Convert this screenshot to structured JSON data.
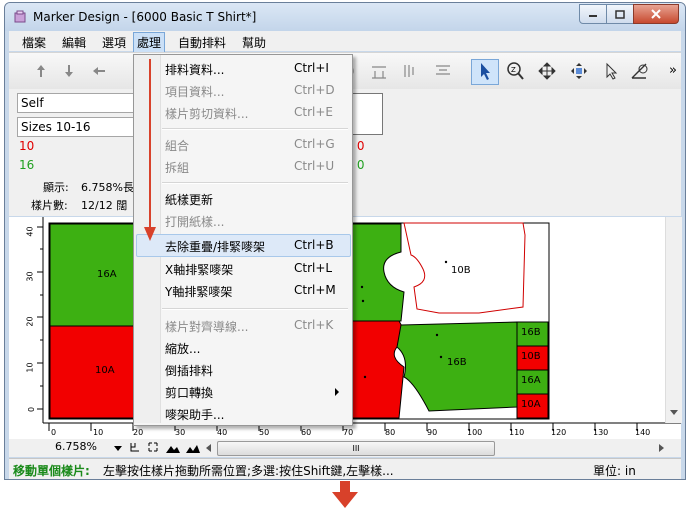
{
  "window": {
    "title": "Marker Design - [6000 Basic T Shirt*]"
  },
  "menubar": [
    "檔案",
    "編輯",
    "選項",
    "處理",
    "自動排料",
    "幫助"
  ],
  "panel": {
    "style_select": "Self",
    "sizes_select": "Sizes 10-16",
    "num_red": "10",
    "num_green": "16",
    "stat_red": ": 0",
    "stat_green": ": 0",
    "display_label": "顯示:",
    "display_value": "6.758%長",
    "pieces_label": "樣片數:",
    "pieces_value": "12/12 闊"
  },
  "menu": {
    "items": [
      {
        "label": "排料資料...",
        "shortcut": "Ctrl+I"
      },
      {
        "label": "項目資料...",
        "shortcut": "Ctrl+D"
      },
      {
        "label": "樣片剪切資料...",
        "shortcut": "Ctrl+E"
      },
      {
        "label": "組合",
        "shortcut": "Ctrl+G"
      },
      {
        "label": "拆組",
        "shortcut": "Ctrl+U"
      },
      {
        "label": "紙樣更新",
        "shortcut": ""
      },
      {
        "label": "打開紙樣...",
        "shortcut": ""
      },
      {
        "label": "去除重疊/排緊嘜架",
        "shortcut": "Ctrl+B"
      },
      {
        "label": "X軸排緊嘜架",
        "shortcut": "Ctrl+L"
      },
      {
        "label": "Y軸排緊嘜架",
        "shortcut": "Ctrl+M"
      },
      {
        "label": "樣片對齊導線...",
        "shortcut": "Ctrl+K"
      },
      {
        "label": "縮放...",
        "shortcut": ""
      },
      {
        "label": "倒插排料",
        "shortcut": ""
      },
      {
        "label": "剪口轉換",
        "shortcut": ""
      },
      {
        "label": "嘜架助手...",
        "shortcut": ""
      }
    ]
  },
  "pieces": [
    "16A",
    "10A",
    "10B",
    "16B",
    "16B",
    "10B",
    "16A",
    "10A"
  ],
  "ruler": {
    "h_ticks": [
      "0",
      "10",
      "20",
      "30",
      "40",
      "50",
      "60",
      "70",
      "80",
      "90",
      "100",
      "110",
      "120",
      "130",
      "140"
    ],
    "v_ticks": [
      "40",
      "30",
      "20",
      "10",
      "0"
    ]
  },
  "zoom": "6.758%",
  "scroll_grip": "III",
  "status": {
    "bold": "移動單個樣片:",
    "text": "左擊按住樣片拖動所需位置;多選:按住Shift鍵,左擊樣...",
    "unit": "單位: in"
  },
  "colors": {
    "green": "#3db012",
    "red": "#f20000",
    "highlight": "#dde9f8",
    "arrow": "#d8412a"
  }
}
